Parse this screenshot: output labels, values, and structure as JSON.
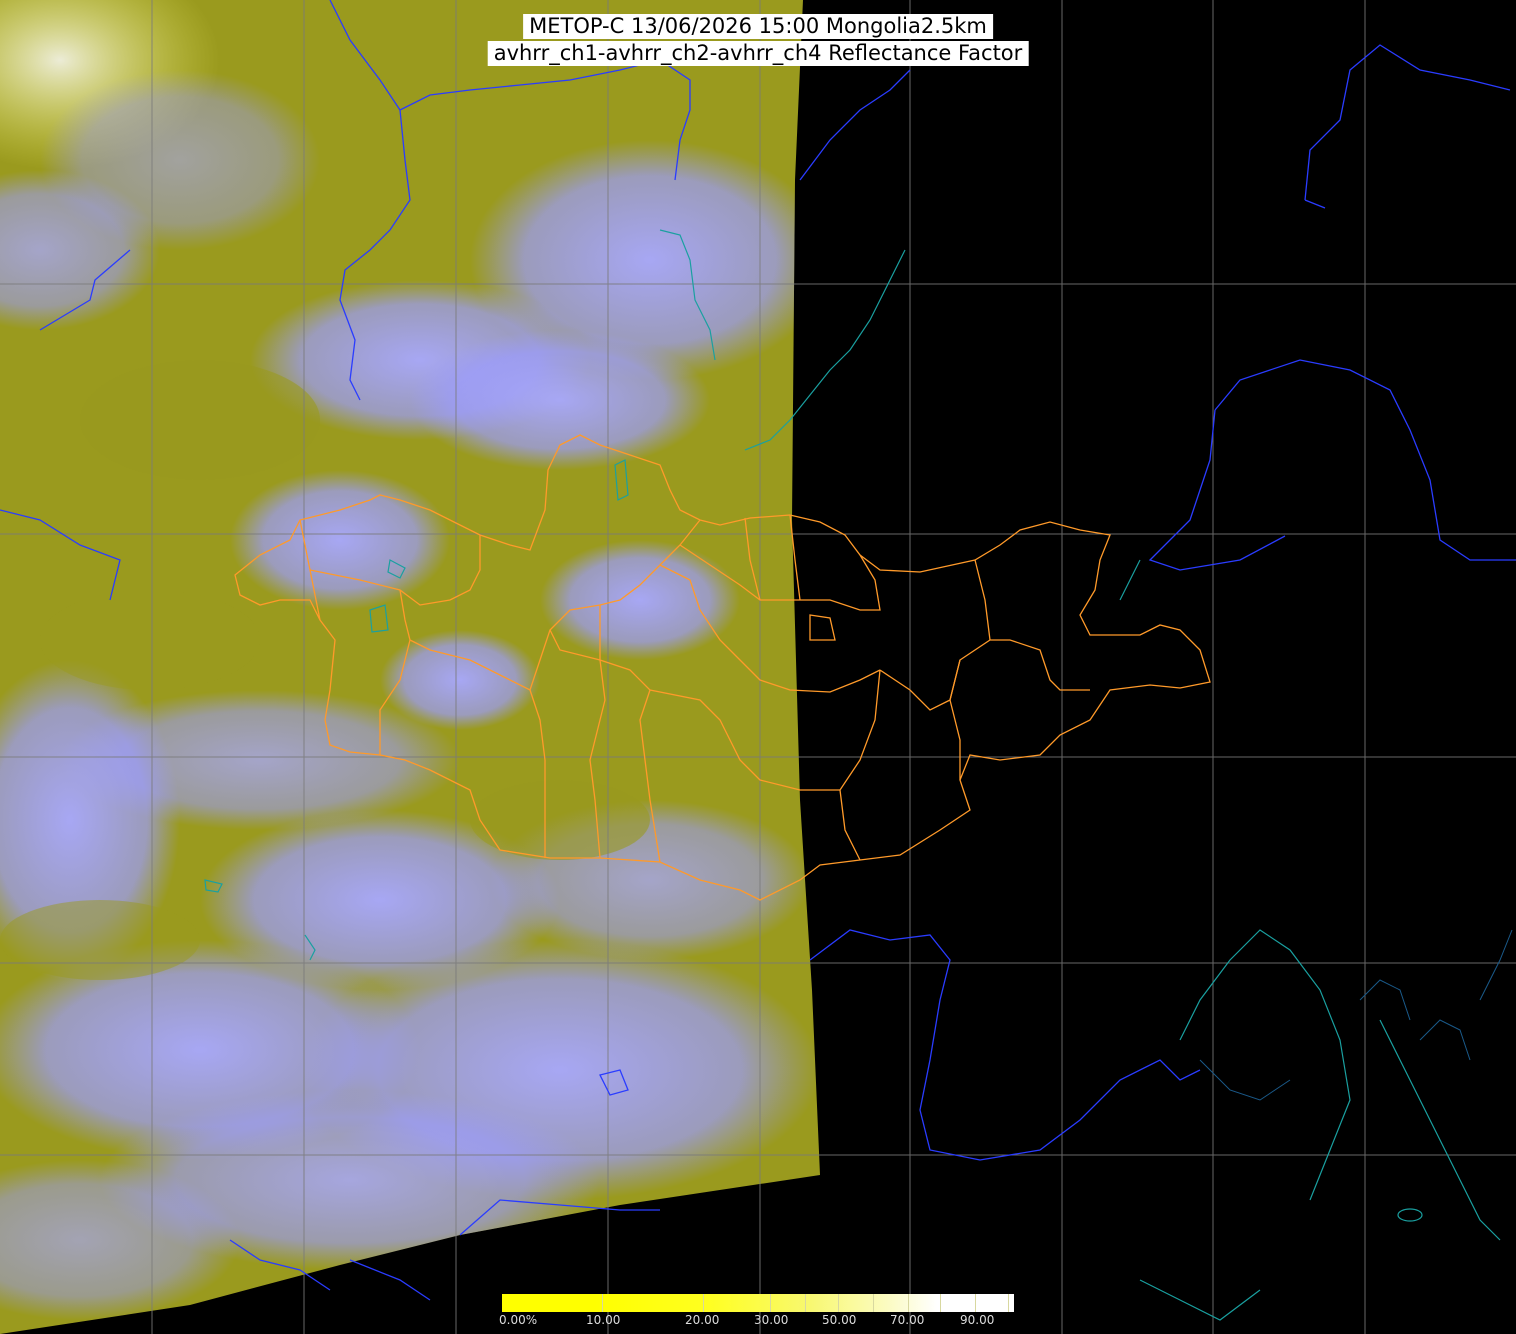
{
  "title": {
    "line1": "METOP-C 13/06/2026 15:00 Mongolia2.5km",
    "line2": "avhrr_ch1-avhrr_ch2-avhrr_ch4 Reflectance Factor"
  },
  "colorbar": {
    "labels": [
      "0.00%",
      "10.00",
      "20.00",
      "30.00",
      "50.00",
      "70.00",
      "90.00"
    ],
    "low_color": "#ffff00",
    "high_color": "#ffffff"
  },
  "colors": {
    "background": "#000000",
    "swath_vegetation": "#9a9a1e",
    "swath_cloud": "#9c9cff",
    "grid": "#808080",
    "coastline": "#2a3cff",
    "lakes": "#1aa0a0",
    "provinces": "#ff9a2a"
  },
  "layers": [
    "satellite-swath",
    "lat-lon-grid",
    "coastlines-and-borders",
    "province-boundaries",
    "colorbar"
  ]
}
